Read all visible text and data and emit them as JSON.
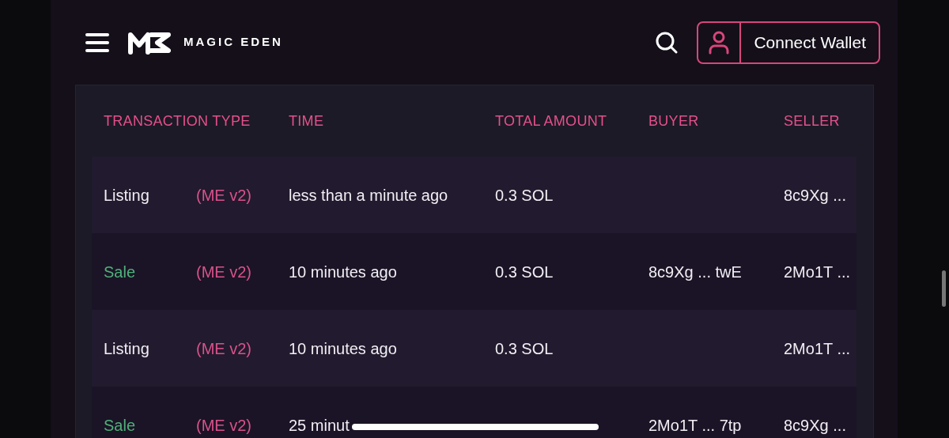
{
  "header": {
    "brand": "MAGIC EDEN",
    "connect_button": "Connect Wallet"
  },
  "table": {
    "columns": [
      "TRANSACTION TYPE",
      "TIME",
      "TOTAL AMOUNT",
      "BUYER",
      "SELLER"
    ],
    "rows": [
      {
        "kind": "listing",
        "type": "Listing",
        "platform": "(ME v2)",
        "time": "less than a minute ago",
        "amount": "0.3 SOL",
        "seller": "8c9Xg ..."
      },
      {
        "kind": "sale",
        "type": "Sale",
        "platform": "(ME v2)",
        "time": "10 minutes ago",
        "amount": "0.3 SOL",
        "buyer": "8c9Xg ... twE",
        "seller": "2Mo1T ..."
      },
      {
        "kind": "listing",
        "type": "Listing",
        "platform": "(ME v2)",
        "time": "10 minutes ago",
        "amount": "0.3 SOL",
        "seller": "2Mo1T ..."
      },
      {
        "kind": "sale",
        "type": "Sale",
        "platform": "(ME v2)",
        "time": "25 minut",
        "buyer": "2Mo1T ... 7tp",
        "seller": "8c9Xg ..."
      }
    ]
  }
}
